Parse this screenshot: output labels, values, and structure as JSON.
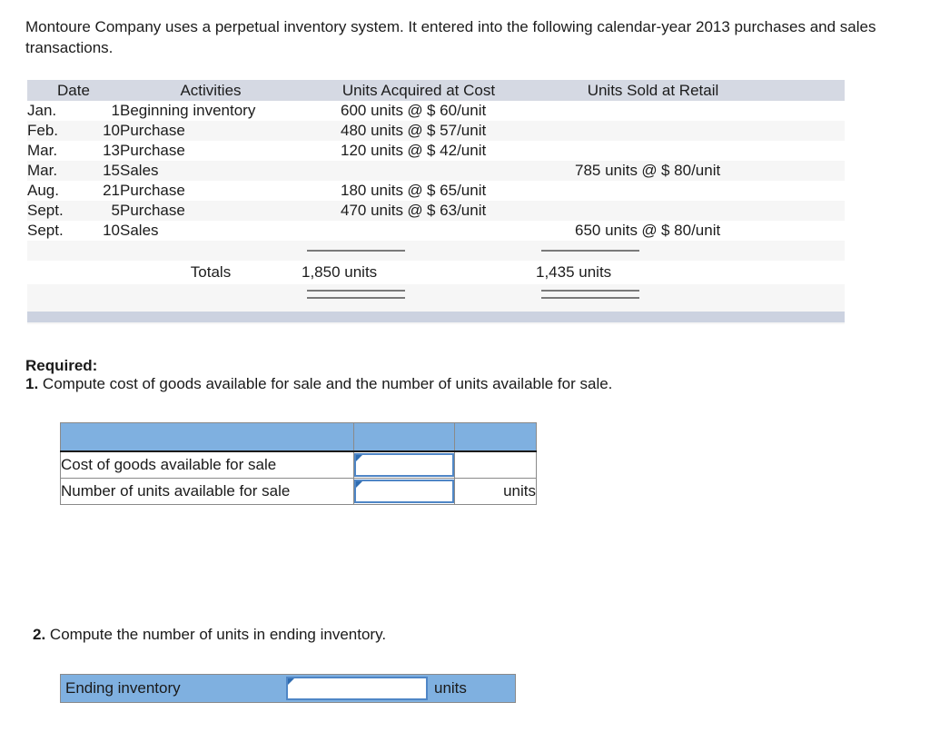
{
  "intro": "Montoure Company uses a perpetual inventory system. It entered into the following calendar-year 2013 purchases and sales transactions.",
  "colors": {
    "table_header_bg": "#d5d9e3",
    "row_alt_bg": "#f6f6f6",
    "footer_bar_bg": "#ccd2e0",
    "form_accent_blue": "#7fb0e0",
    "input_border_blue": "#4f86c6"
  },
  "inventory_table": {
    "headers": {
      "date": "Date",
      "activities": "Activities",
      "units_acquired": "Units Acquired at Cost",
      "units_sold": "Units Sold at Retail"
    },
    "rows": [
      {
        "month": "Jan.",
        "day": "1",
        "activity": "Beginning inventory",
        "acq_units": "600 units",
        "acq_at": "@",
        "acq_price": "$ 60/unit",
        "sold_units": "",
        "sold_at": "",
        "sold_price": ""
      },
      {
        "month": "Feb.",
        "day": "10",
        "activity": "Purchase",
        "acq_units": "480 units",
        "acq_at": "@",
        "acq_price": "$ 57/unit",
        "sold_units": "",
        "sold_at": "",
        "sold_price": ""
      },
      {
        "month": "Mar.",
        "day": "13",
        "activity": "Purchase",
        "acq_units": "120 units",
        "acq_at": "@",
        "acq_price": "$ 42/unit",
        "sold_units": "",
        "sold_at": "",
        "sold_price": ""
      },
      {
        "month": "Mar.",
        "day": "15",
        "activity": "Sales",
        "acq_units": "",
        "acq_at": "",
        "acq_price": "",
        "sold_units": "785 units",
        "sold_at": "@",
        "sold_price": "$ 80/unit"
      },
      {
        "month": "Aug.",
        "day": "21",
        "activity": "Purchase",
        "acq_units": "180 units",
        "acq_at": "@",
        "acq_price": "$ 65/unit",
        "sold_units": "",
        "sold_at": "",
        "sold_price": ""
      },
      {
        "month": "Sept.",
        "day": "5",
        "activity": "Purchase",
        "acq_units": "470 units",
        "acq_at": "@",
        "acq_price": "$ 63/unit",
        "sold_units": "",
        "sold_at": "",
        "sold_price": ""
      },
      {
        "month": "Sept.",
        "day": "10",
        "activity": "Sales",
        "acq_units": "",
        "acq_at": "",
        "acq_price": "",
        "sold_units": "650 units",
        "sold_at": "@",
        "sold_price": "$ 80/unit"
      }
    ],
    "totals": {
      "label": "Totals",
      "acquired": "1,850 units",
      "sold": "1,435 units"
    }
  },
  "required": {
    "heading": "Required:",
    "q1_num": "1.",
    "q1_text": "Compute cost of goods available for sale and the number of units available for sale.",
    "q2_num": "2.",
    "q2_text": "Compute the number of units in ending inventory."
  },
  "answer_form_1": {
    "rows": [
      {
        "label": "Cost of goods available for sale",
        "value": "",
        "units": ""
      },
      {
        "label": "Number of units available for sale",
        "value": "",
        "units": "units"
      }
    ]
  },
  "answer_form_2": {
    "label": "Ending inventory",
    "value": "",
    "units": "units"
  }
}
